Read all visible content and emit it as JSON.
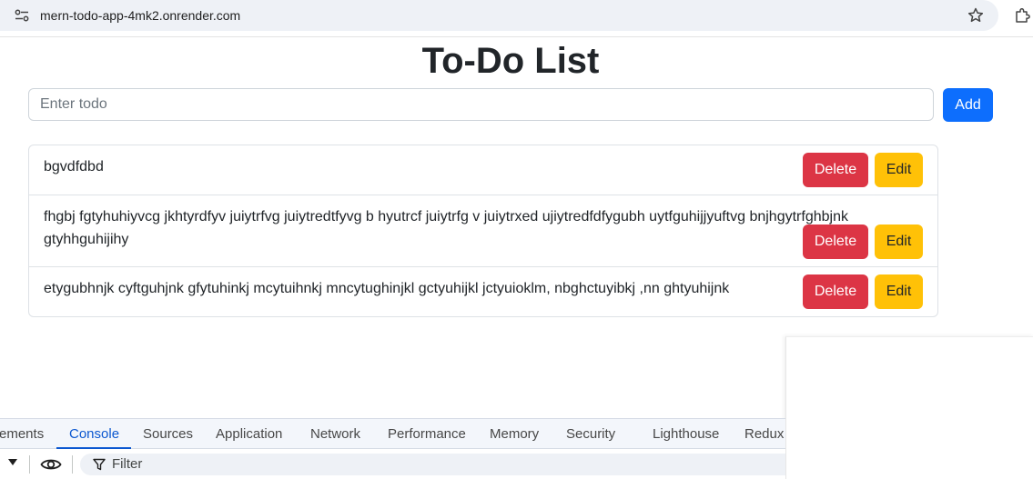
{
  "browser": {
    "url": "mern-todo-app-4mk2.onrender.com",
    "icons": [
      "site-settings-icon",
      "bookmark-star-icon",
      "extensions-icon"
    ]
  },
  "app": {
    "title": "To-Do List",
    "input_placeholder": "Enter todo",
    "add_label": "Add",
    "todos": [
      {
        "text": "bgvdfdbd",
        "delete_label": "Delete",
        "edit_label": "Edit"
      },
      {
        "text": "fhgbj fgtyhuhiyvcg jkhtyrdfyv juiytrfvg juiytredtfyvg b hyutrcf juiytrfg v juiytrxed ujiytredfdfygubh uytfguhijjyuftvg bnjhgytrfghbjnk gtyhhguhijihy",
        "delete_label": "Delete",
        "edit_label": "Edit"
      },
      {
        "text": "etygubhnjk cyftguhjnk gfytuhinkj mcytuihnkj mncytughinjkl gctyuhijkl jctyuioklm, nbghctuyibkj ,nn ghtyuhijnk",
        "delete_label": "Delete",
        "edit_label": "Edit"
      }
    ],
    "colors": {
      "primary": "#0d6efd",
      "danger": "#dc3545",
      "warning": "#ffc107"
    }
  },
  "devtools": {
    "tabs": [
      "ements",
      "Console",
      "Sources",
      "Application",
      "Network",
      "Performance",
      "Memory",
      "Security",
      "Lighthouse",
      "Redux"
    ],
    "active_tab": "Console",
    "filter_placeholder": "Filter",
    "accent": "#0b57d0"
  }
}
